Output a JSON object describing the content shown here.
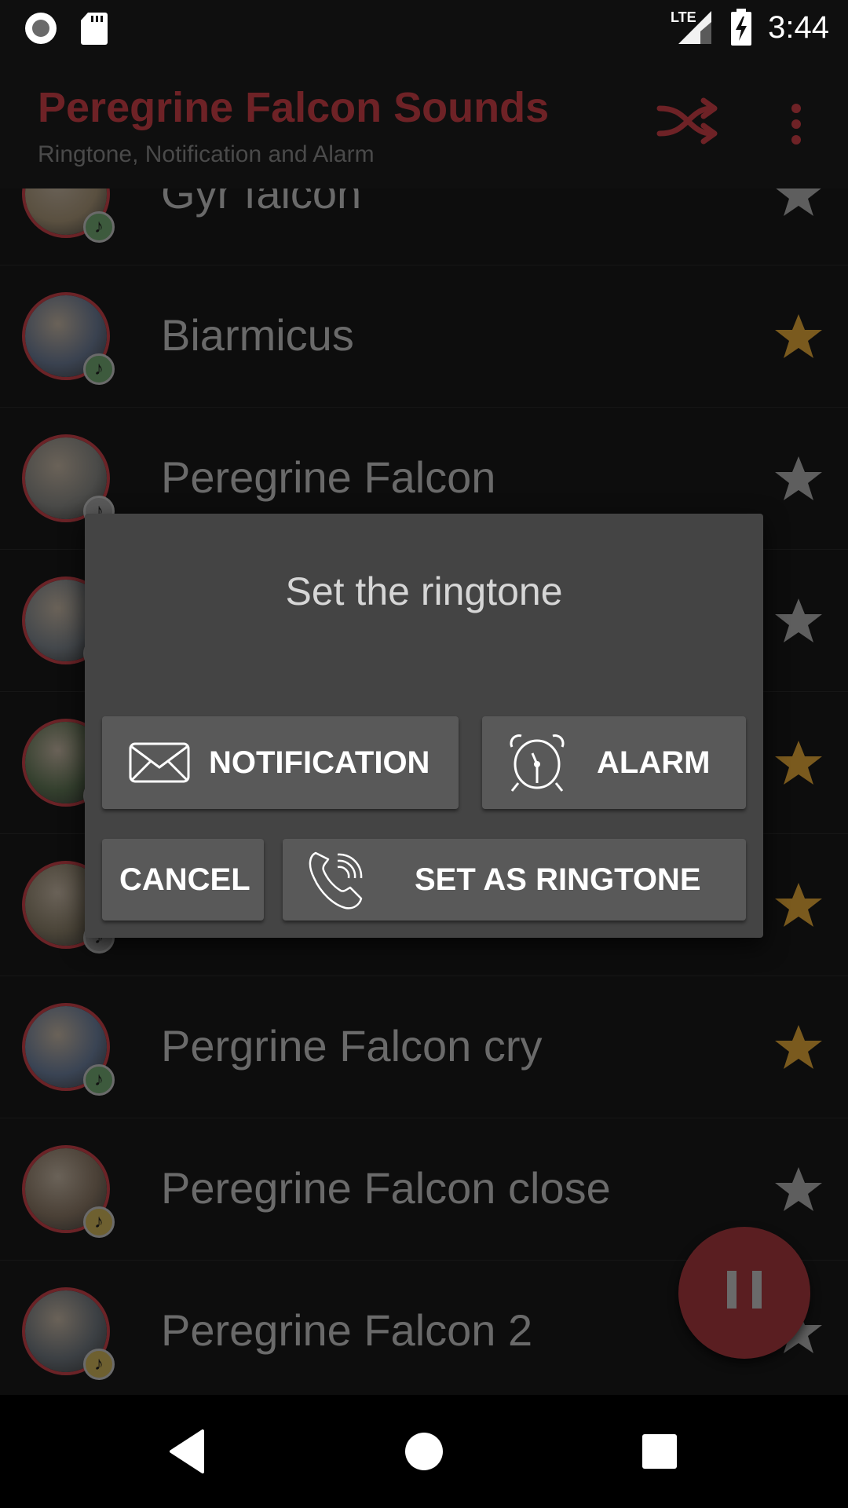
{
  "status_bar": {
    "time": "3:44",
    "network": "LTE",
    "icons": [
      "record-icon",
      "sd-card-icon",
      "lte-signal-icon",
      "battery-charging-icon"
    ]
  },
  "app_bar": {
    "title": "Peregrine Falcon Sounds",
    "subtitle": "Ringtone, Notification and Alarm",
    "actions": [
      "shuffle-icon",
      "overflow-menu-icon"
    ]
  },
  "colors": {
    "accent": "#6e2226",
    "star_on": "#7a5a1e",
    "star_off": "#5e5e5e",
    "badge_green": "#3d5a3d",
    "badge_gold": "#6e6030",
    "badge_gray": "#5a5a5a",
    "dialog_bg": "#444444",
    "button_bg": "#595959"
  },
  "sounds": [
    {
      "title": "Gyr falcon",
      "favorite": false,
      "badge": "green",
      "avatar": "#5a5040"
    },
    {
      "title": "Biarmicus",
      "favorite": true,
      "badge": "green",
      "avatar": "#3a4250"
    },
    {
      "title": "Peregrine Falcon",
      "favorite": false,
      "badge": "gray",
      "avatar": "#4a4a48"
    },
    {
      "title": "",
      "favorite": false,
      "badge": "gray",
      "avatar": "#44484c"
    },
    {
      "title": "",
      "favorite": true,
      "badge": "gray",
      "avatar": "#34402e"
    },
    {
      "title": "",
      "favorite": true,
      "badge": "gray",
      "avatar": "#4a4438"
    },
    {
      "title": "Pergrine Falcon cry",
      "favorite": true,
      "badge": "green",
      "avatar": "#3a4454"
    },
    {
      "title": "Peregrine Falcon close",
      "favorite": false,
      "badge": "gold",
      "avatar": "#4a4036"
    },
    {
      "title": "Peregrine Falcon 2",
      "favorite": false,
      "badge": "gold",
      "avatar": "#3c4044"
    }
  ],
  "dialog": {
    "title": "Set the ringtone",
    "notification_label": "NOTIFICATION",
    "alarm_label": "ALARM",
    "cancel_label": "CANCEL",
    "ringtone_label": "SET AS RINGTONE"
  },
  "player": {
    "state": "playing",
    "fab_icon": "pause-icon"
  },
  "nav_bar": {
    "buttons": [
      "back-icon",
      "home-icon",
      "recents-icon"
    ]
  }
}
